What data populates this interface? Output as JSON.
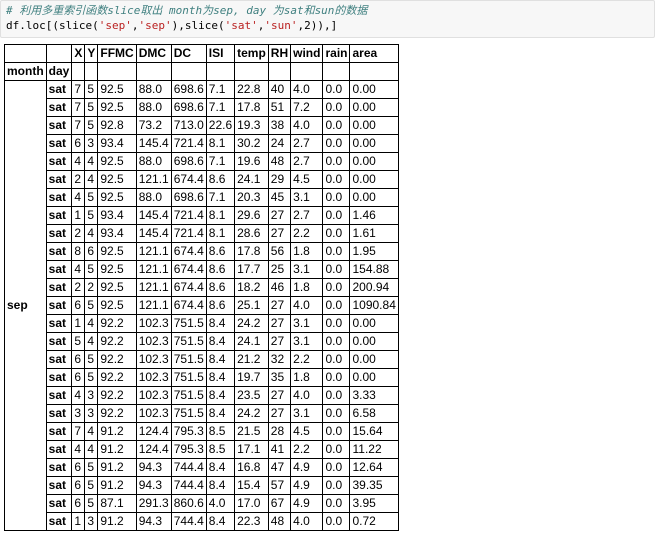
{
  "code_cell": {
    "comment": "# 利用多重索引函数slice取出 month为sep, day 为sat和sun的数据",
    "code_prefix": "df.loc[(slice(",
    "code_str1": "'sep'",
    "code_comma1": ",",
    "code_str2": "'sep'",
    "code_mid": "),slice(",
    "code_str3": "'sat'",
    "code_comma2": ",",
    "code_str4": "'sun'",
    "code_suffix": ",2)),]"
  },
  "table": {
    "columns": [
      "X",
      "Y",
      "FFMC",
      "DMC",
      "DC",
      "ISI",
      "temp",
      "RH",
      "wind",
      "rain",
      "area"
    ],
    "index_names": [
      "month",
      "day"
    ],
    "month": "sep",
    "rows": [
      {
        "day": "sat",
        "cells": [
          "7",
          "5",
          "92.5",
          "88.0",
          "698.6",
          "7.1",
          "22.8",
          "40",
          "4.0",
          "0.0",
          "0.00"
        ]
      },
      {
        "day": "sat",
        "cells": [
          "7",
          "5",
          "92.5",
          "88.0",
          "698.6",
          "7.1",
          "17.8",
          "51",
          "7.2",
          "0.0",
          "0.00"
        ]
      },
      {
        "day": "sat",
        "cells": [
          "7",
          "5",
          "92.8",
          "73.2",
          "713.0",
          "22.6",
          "19.3",
          "38",
          "4.0",
          "0.0",
          "0.00"
        ]
      },
      {
        "day": "sat",
        "cells": [
          "6",
          "3",
          "93.4",
          "145.4",
          "721.4",
          "8.1",
          "30.2",
          "24",
          "2.7",
          "0.0",
          "0.00"
        ]
      },
      {
        "day": "sat",
        "cells": [
          "4",
          "4",
          "92.5",
          "88.0",
          "698.6",
          "7.1",
          "19.6",
          "48",
          "2.7",
          "0.0",
          "0.00"
        ]
      },
      {
        "day": "sat",
        "cells": [
          "2",
          "4",
          "92.5",
          "121.1",
          "674.4",
          "8.6",
          "24.1",
          "29",
          "4.5",
          "0.0",
          "0.00"
        ]
      },
      {
        "day": "sat",
        "cells": [
          "4",
          "5",
          "92.5",
          "88.0",
          "698.6",
          "7.1",
          "20.3",
          "45",
          "3.1",
          "0.0",
          "0.00"
        ]
      },
      {
        "day": "sat",
        "cells": [
          "1",
          "5",
          "93.4",
          "145.4",
          "721.4",
          "8.1",
          "29.6",
          "27",
          "2.7",
          "0.0",
          "1.46"
        ]
      },
      {
        "day": "sat",
        "cells": [
          "2",
          "4",
          "93.4",
          "145.4",
          "721.4",
          "8.1",
          "28.6",
          "27",
          "2.2",
          "0.0",
          "1.61"
        ]
      },
      {
        "day": "sat",
        "cells": [
          "8",
          "6",
          "92.5",
          "121.1",
          "674.4",
          "8.6",
          "17.8",
          "56",
          "1.8",
          "0.0",
          "1.95"
        ]
      },
      {
        "day": "sat",
        "cells": [
          "4",
          "5",
          "92.5",
          "121.1",
          "674.4",
          "8.6",
          "17.7",
          "25",
          "3.1",
          "0.0",
          "154.88"
        ]
      },
      {
        "day": "sat",
        "cells": [
          "2",
          "2",
          "92.5",
          "121.1",
          "674.4",
          "8.6",
          "18.2",
          "46",
          "1.8",
          "0.0",
          "200.94"
        ]
      },
      {
        "day": "sat",
        "cells": [
          "6",
          "5",
          "92.5",
          "121.1",
          "674.4",
          "8.6",
          "25.1",
          "27",
          "4.0",
          "0.0",
          "1090.84"
        ]
      },
      {
        "day": "sat",
        "cells": [
          "1",
          "4",
          "92.2",
          "102.3",
          "751.5",
          "8.4",
          "24.2",
          "27",
          "3.1",
          "0.0",
          "0.00"
        ]
      },
      {
        "day": "sat",
        "cells": [
          "5",
          "4",
          "92.2",
          "102.3",
          "751.5",
          "8.4",
          "24.1",
          "27",
          "3.1",
          "0.0",
          "0.00"
        ]
      },
      {
        "day": "sat",
        "cells": [
          "6",
          "5",
          "92.2",
          "102.3",
          "751.5",
          "8.4",
          "21.2",
          "32",
          "2.2",
          "0.0",
          "0.00"
        ]
      },
      {
        "day": "sat",
        "cells": [
          "6",
          "5",
          "92.2",
          "102.3",
          "751.5",
          "8.4",
          "19.7",
          "35",
          "1.8",
          "0.0",
          "0.00"
        ]
      },
      {
        "day": "sat",
        "cells": [
          "4",
          "3",
          "92.2",
          "102.3",
          "751.5",
          "8.4",
          "23.5",
          "27",
          "4.0",
          "0.0",
          "3.33"
        ]
      },
      {
        "day": "sat",
        "cells": [
          "3",
          "3",
          "92.2",
          "102.3",
          "751.5",
          "8.4",
          "24.2",
          "27",
          "3.1",
          "0.0",
          "6.58"
        ]
      },
      {
        "day": "sat",
        "cells": [
          "7",
          "4",
          "91.2",
          "124.4",
          "795.3",
          "8.5",
          "21.5",
          "28",
          "4.5",
          "0.0",
          "15.64"
        ]
      },
      {
        "day": "sat",
        "cells": [
          "4",
          "4",
          "91.2",
          "124.4",
          "795.3",
          "8.5",
          "17.1",
          "41",
          "2.2",
          "0.0",
          "11.22"
        ]
      },
      {
        "day": "sat",
        "cells": [
          "6",
          "5",
          "91.2",
          "94.3",
          "744.4",
          "8.4",
          "16.8",
          "47",
          "4.9",
          "0.0",
          "12.64"
        ]
      },
      {
        "day": "sat",
        "cells": [
          "6",
          "5",
          "91.2",
          "94.3",
          "744.4",
          "8.4",
          "15.4",
          "57",
          "4.9",
          "0.0",
          "39.35"
        ]
      },
      {
        "day": "sat",
        "cells": [
          "6",
          "5",
          "87.1",
          "291.3",
          "860.6",
          "4.0",
          "17.0",
          "67",
          "4.9",
          "0.0",
          "3.95"
        ]
      },
      {
        "day": "sat",
        "cells": [
          "1",
          "3",
          "91.2",
          "94.3",
          "744.4",
          "8.4",
          "22.3",
          "48",
          "4.0",
          "0.0",
          "0.72"
        ]
      }
    ]
  }
}
